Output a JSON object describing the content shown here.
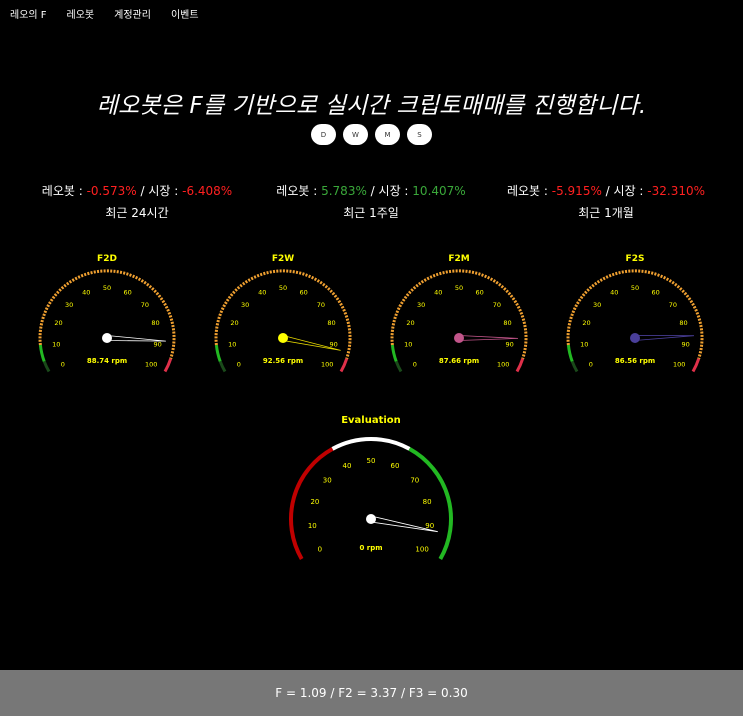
{
  "nav": {
    "items": [
      "레오의 F",
      "레오봇",
      "계정관리",
      "이벤트"
    ]
  },
  "headline": "레오봇은 F를 기반으로 실시간 크립토매매를 진행합니다.",
  "period_buttons": [
    "D",
    "W",
    "M",
    "S"
  ],
  "stats": [
    {
      "bot_label": "레오봇 : ",
      "bot_value": "-0.573%",
      "bot_sign": "neg",
      "sep": " / 시장 : ",
      "market_value": "-6.408%",
      "market_sign": "neg",
      "period": "최근 24시간"
    },
    {
      "bot_label": "레오봇 : ",
      "bot_value": "5.783%",
      "bot_sign": "pos",
      "sep": " / 시장 : ",
      "market_value": "10.407%",
      "market_sign": "pos",
      "period": "최근 1주일"
    },
    {
      "bot_label": "레오봇 : ",
      "bot_value": "-5.915%",
      "bot_sign": "neg",
      "sep": " / 시장 : ",
      "market_value": "-32.310%",
      "market_sign": "neg",
      "period": "최근 1개월"
    }
  ],
  "gauges": [
    {
      "title": "F2D",
      "value": 88.74,
      "readout": "88.74 rpm",
      "hub_color": "#ffffff",
      "needle_color": "#ffffff"
    },
    {
      "title": "F2W",
      "value": 92.56,
      "readout": "92.56 rpm",
      "hub_color": "#ffff00",
      "needle_color": "#e6d800"
    },
    {
      "title": "F2M",
      "value": 87.66,
      "readout": "87.66 rpm",
      "hub_color": "#c2558a",
      "needle_color": "#c2558a"
    },
    {
      "title": "F2S",
      "value": 86.56,
      "readout": "86.56 rpm",
      "hub_color": "#4a3f9a",
      "needle_color": "#4a3f9a"
    }
  ],
  "gauge_ticks": [
    "0",
    "10",
    "20",
    "30",
    "40",
    "50",
    "60",
    "70",
    "80",
    "90",
    "100"
  ],
  "evaluation": {
    "title": "Evaluation",
    "value": 92,
    "readout": "0 rpm"
  },
  "colors": {
    "accent_yellow": "#ffff00",
    "orange": "#f0a030",
    "green": "#22b822",
    "red": "#c00000",
    "footer_bg": "#777777"
  },
  "footer": "F = 1.09 / F2 = 3.37 / F3 = 0.30"
}
